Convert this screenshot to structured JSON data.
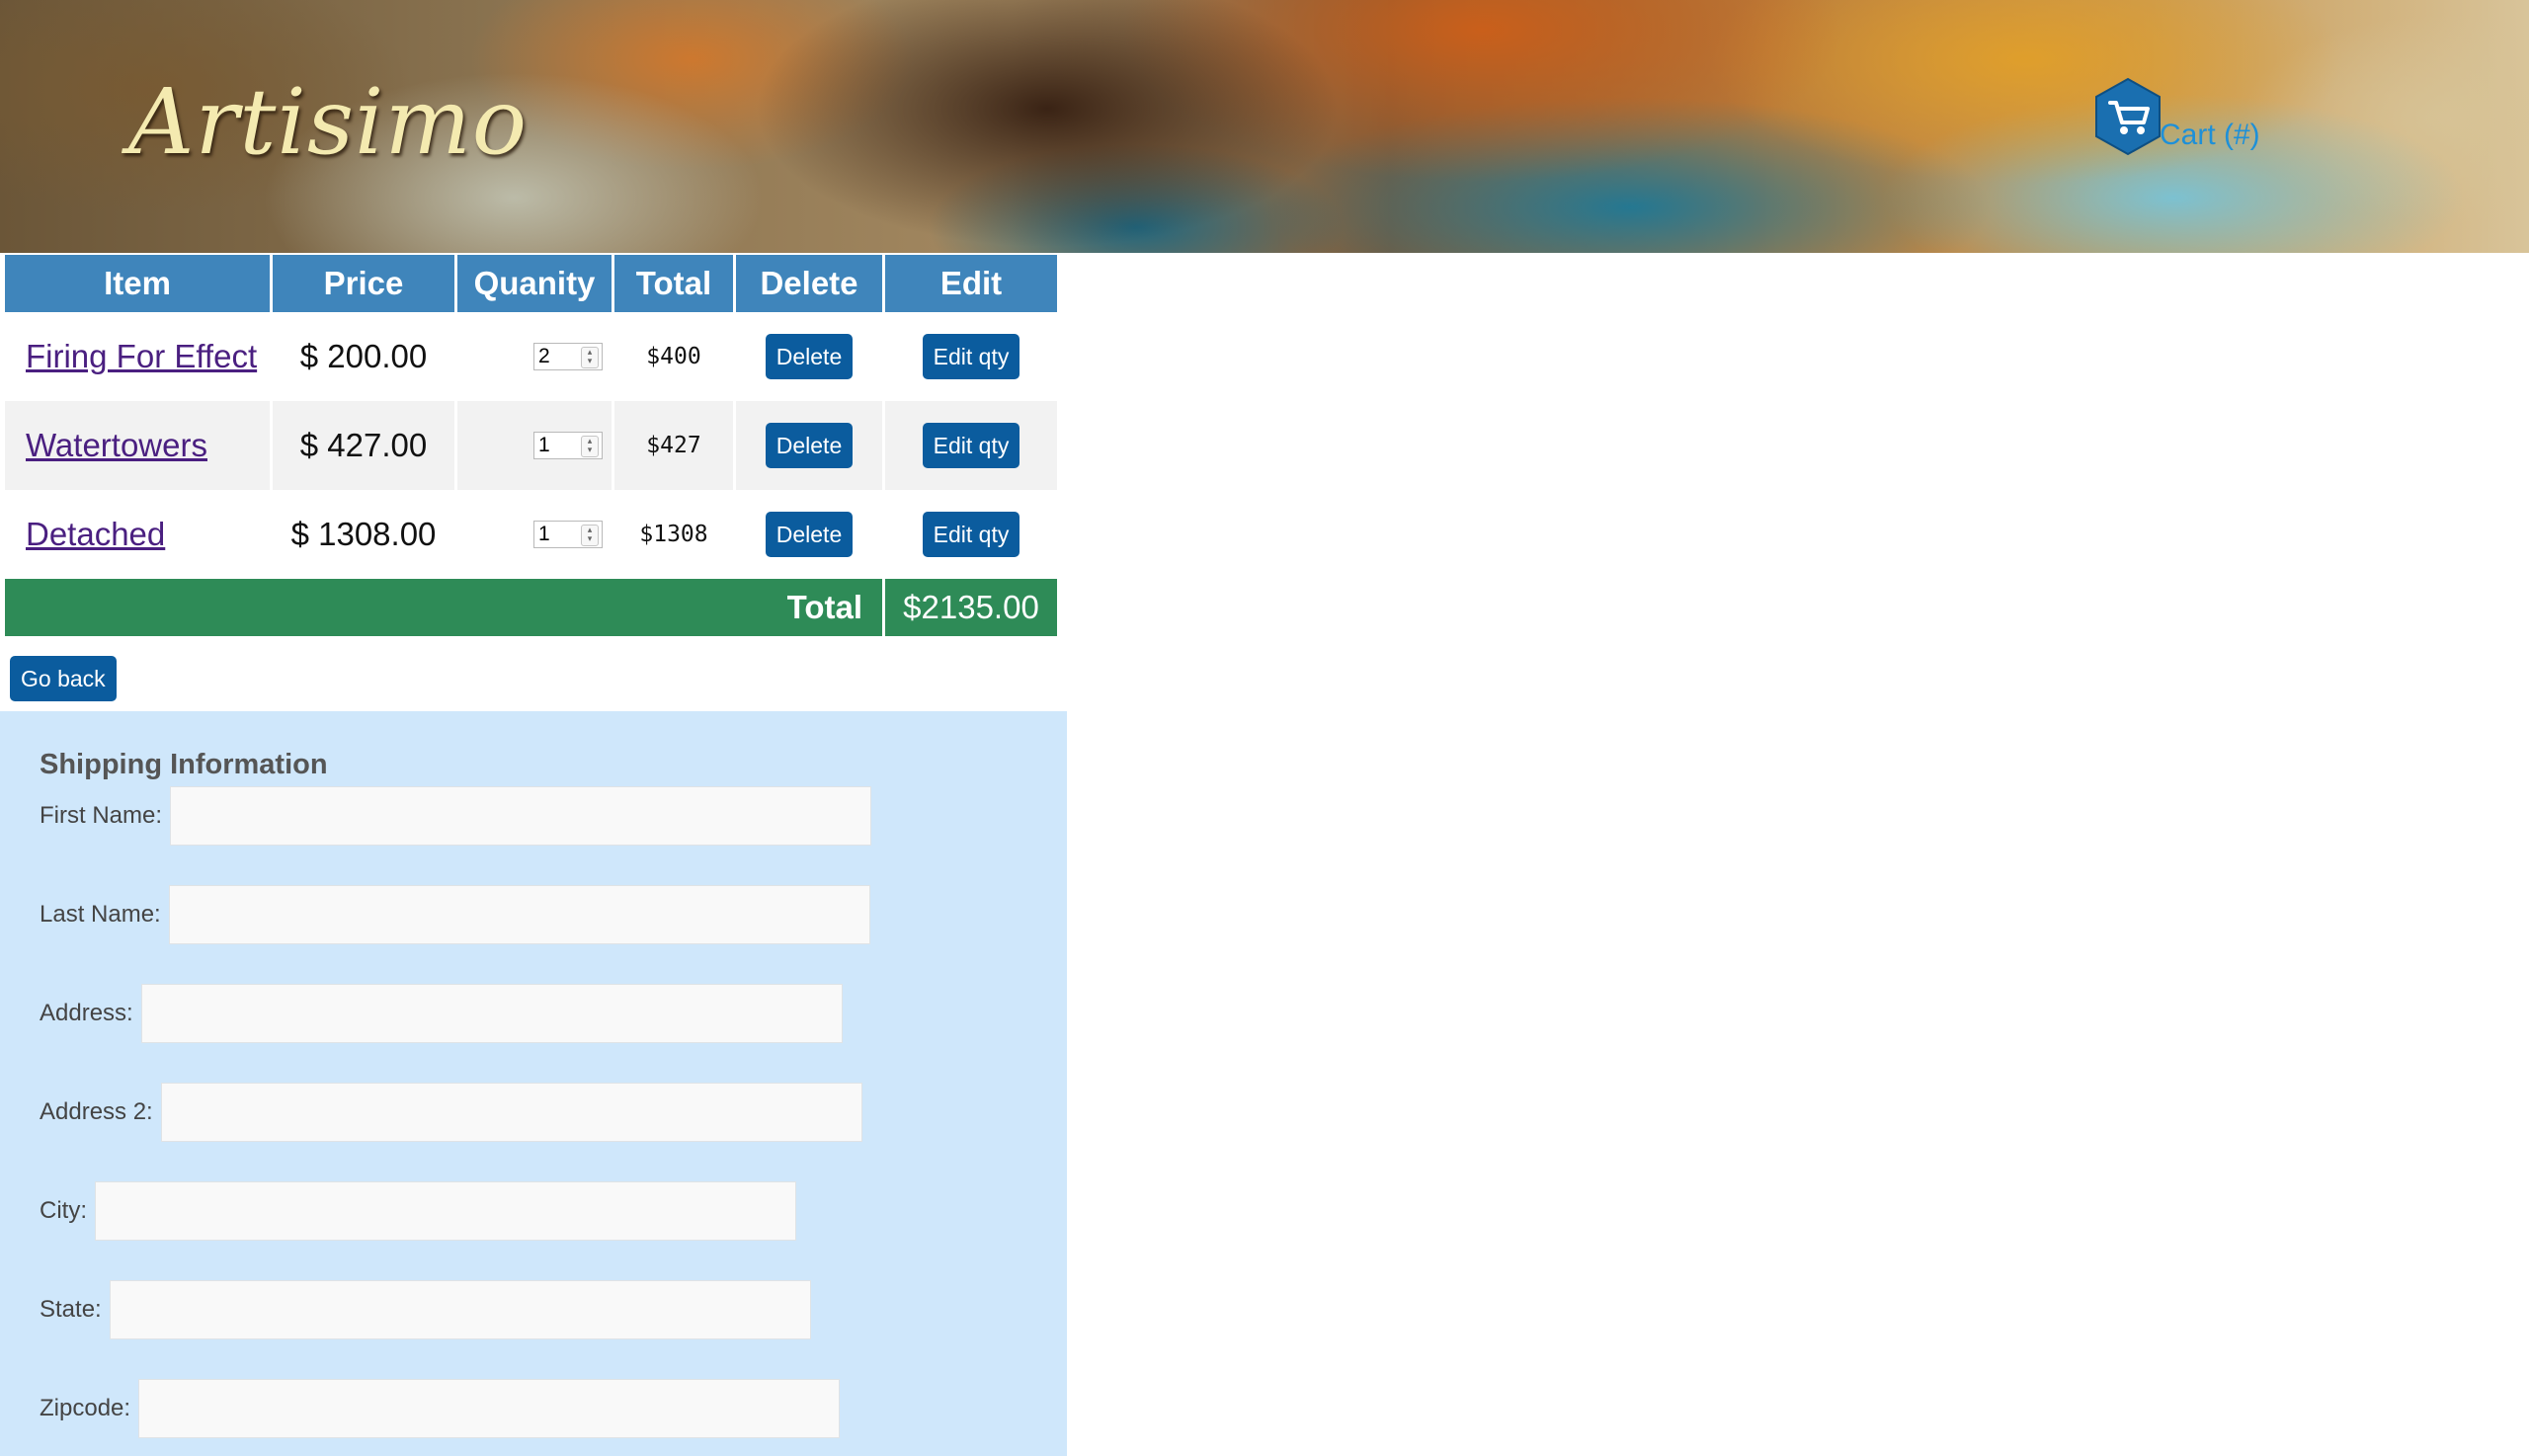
{
  "header": {
    "brand": "Artisimo",
    "cart_label": "Cart (#)",
    "cart_icon": "shopping-cart-icon"
  },
  "cart": {
    "columns": [
      "Item",
      "Price",
      "Quanity",
      "Total",
      "Delete",
      "Edit"
    ],
    "rows": [
      {
        "item": "Firing For Effect",
        "price": "$ 200.00",
        "qty": "2",
        "total": "$400",
        "delete_label": "Delete",
        "edit_label": "Edit qty"
      },
      {
        "item": "Watertowers",
        "price": "$ 427.00",
        "qty": "1",
        "total": "$427",
        "delete_label": "Delete",
        "edit_label": "Edit qty"
      },
      {
        "item": "Detached",
        "price": "$ 1308.00",
        "qty": "1",
        "total": "$1308",
        "delete_label": "Delete",
        "edit_label": "Edit qty"
      }
    ],
    "total_label": "Total",
    "total_value": "$2135.00"
  },
  "actions": {
    "go_back": "Go back"
  },
  "shipping": {
    "title": "Shipping Information",
    "fields": {
      "first_name": {
        "label": "First Name:",
        "value": ""
      },
      "last_name": {
        "label": "Last Name:",
        "value": ""
      },
      "address": {
        "label": "Address:",
        "value": ""
      },
      "address2": {
        "label": "Address 2:",
        "value": ""
      },
      "city": {
        "label": "City:",
        "value": ""
      },
      "state": {
        "label": "State:",
        "value": ""
      },
      "zipcode": {
        "label": "Zipcode:",
        "value": ""
      }
    }
  },
  "colors": {
    "header_blue": "#3f85bb",
    "button_blue": "#0b5c9e",
    "total_green": "#2e8b57",
    "shipping_bg": "#cfe7fb",
    "link_purple": "#4a1f80",
    "cart_link_blue": "#1e90d8"
  }
}
